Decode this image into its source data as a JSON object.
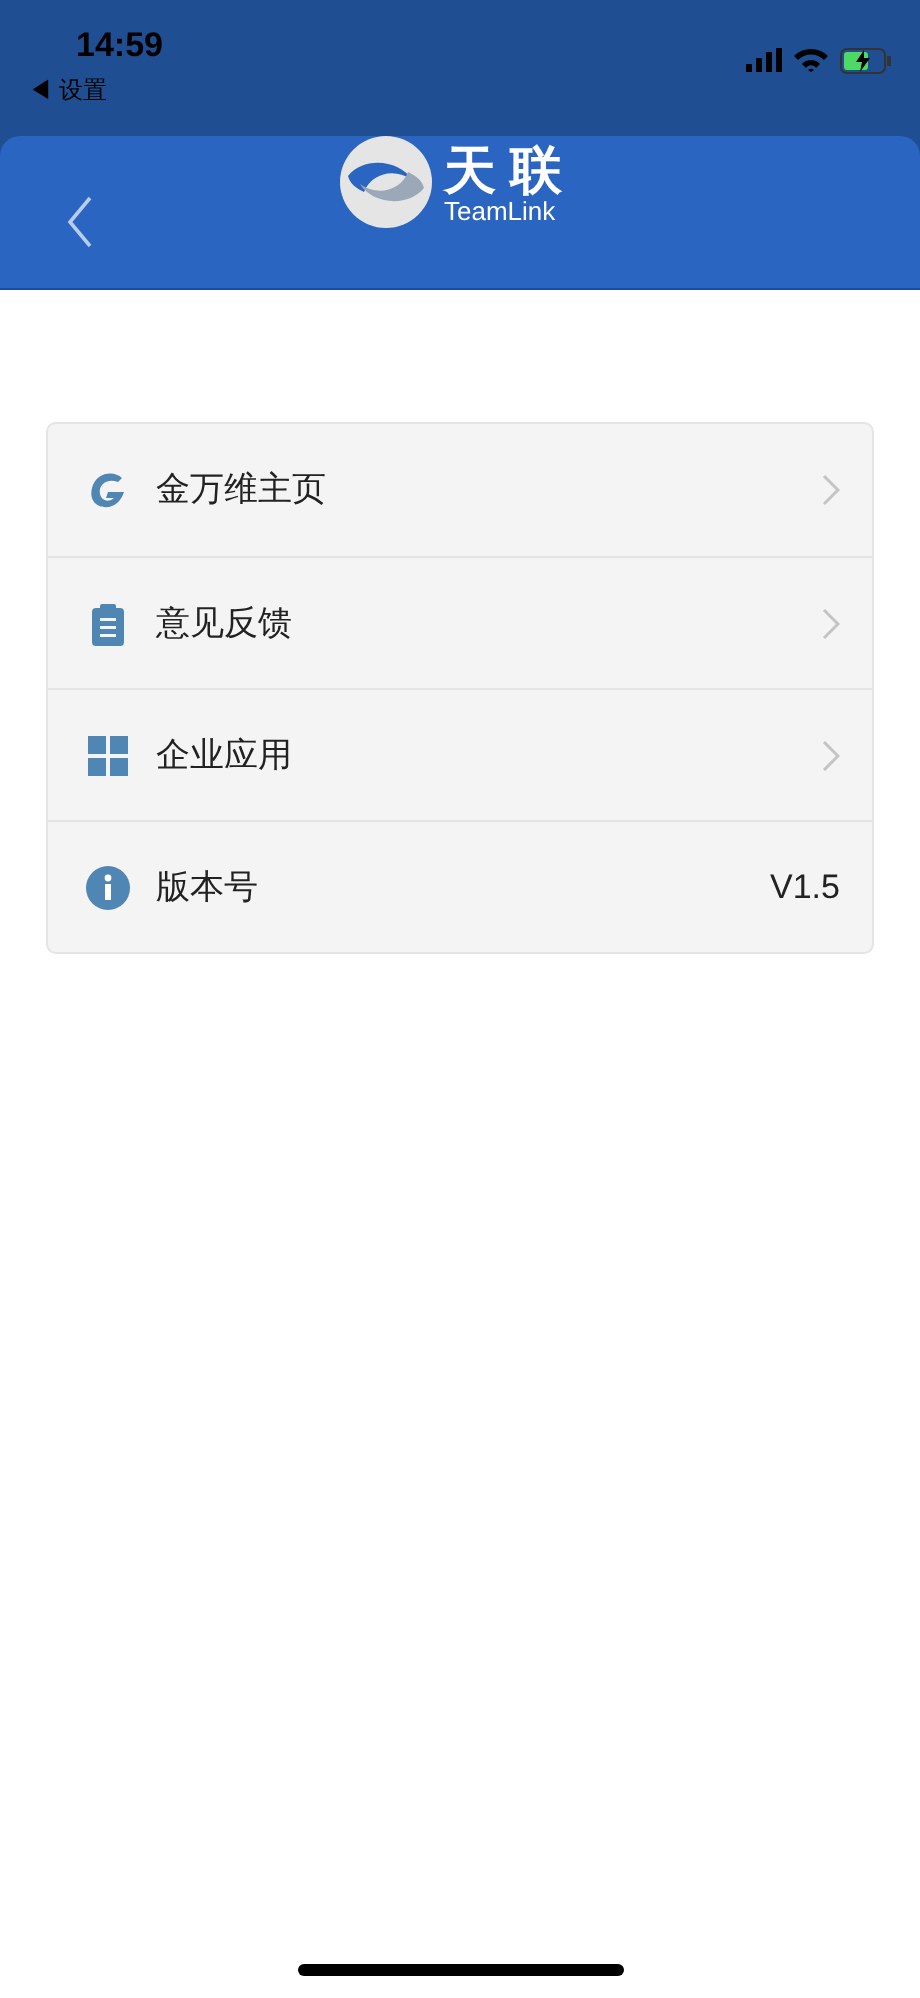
{
  "status_bar": {
    "time": "14:59",
    "back_label": "◀ 设置"
  },
  "header": {
    "logo_title": "天 联",
    "logo_subtitle": "TeamLink"
  },
  "menu": [
    {
      "kind": "link",
      "label": "金万维主页"
    },
    {
      "kind": "link",
      "label": "意见反馈"
    },
    {
      "kind": "link",
      "label": "企业应用"
    },
    {
      "kind": "value",
      "label": "版本号",
      "value": "V1.5"
    }
  ]
}
